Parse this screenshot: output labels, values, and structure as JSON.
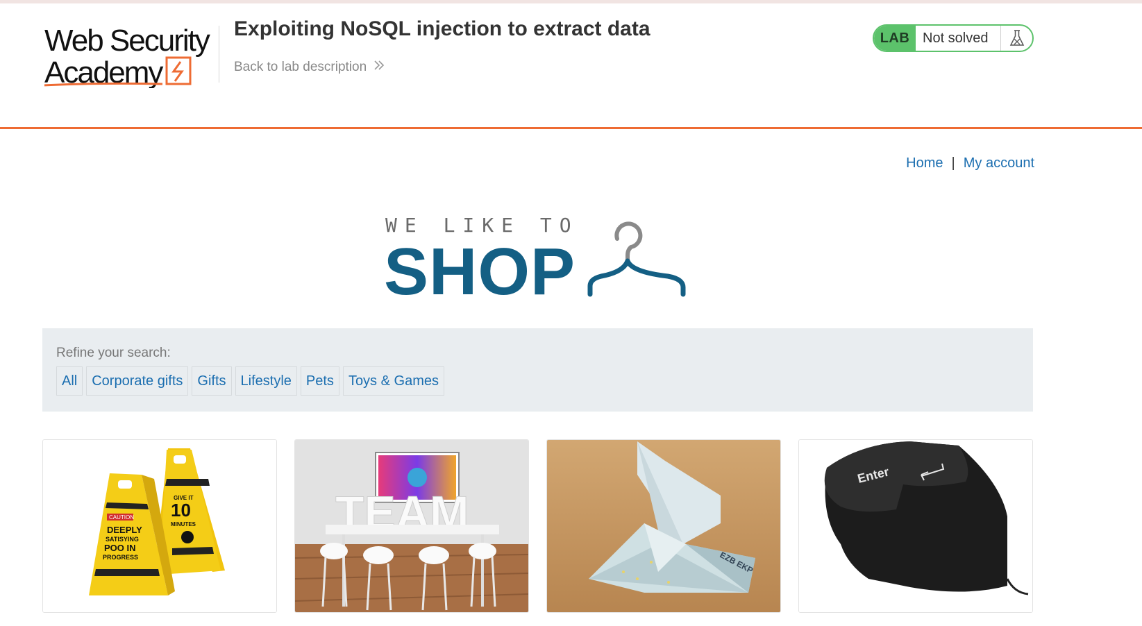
{
  "academy": {
    "logo_line1": "Web Security",
    "logo_line2": "Academy",
    "lab_title": "Exploiting NoSQL injection to extract data",
    "back_link": "Back to lab description",
    "lab_badge": "LAB",
    "lab_status": "Not solved",
    "lab_icon": "flask-icon"
  },
  "nav": {
    "home": "Home",
    "separator": "|",
    "my_account": "My account"
  },
  "shop_logo": {
    "small": "WE LIKE TO",
    "big": "SHOP",
    "icon": "hanger-icon"
  },
  "filters": {
    "label": "Refine your search:",
    "items": [
      "All",
      "Corporate gifts",
      "Gifts",
      "Lifestyle",
      "Pets",
      "Toys & Games"
    ]
  },
  "products": [
    {
      "image": "wet-floor-signs",
      "sign_left": [
        "CAUTION",
        "DEEPLY",
        "SATISYING",
        "POO IN",
        "PROGRESS"
      ],
      "sign_right": [
        "GIVE IT",
        "10",
        "MINUTES"
      ]
    },
    {
      "image": "team-office",
      "text": "TEAM"
    },
    {
      "image": "origami-bird",
      "text": "EZB EKP"
    },
    {
      "image": "giant-enter-key",
      "text": "Enter"
    }
  ],
  "colors": {
    "accent_orange": "#ee6b33",
    "lab_green": "#5cc26b",
    "link_blue": "#1b6eb0",
    "shop_blue": "#145f84",
    "filter_bg": "#e9edf0"
  }
}
